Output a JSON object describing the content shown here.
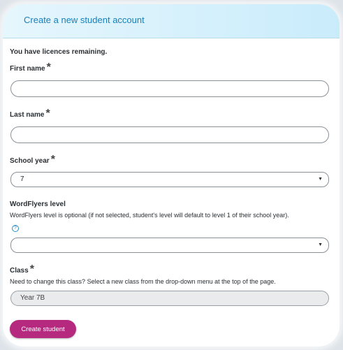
{
  "header": {
    "title": "Create a new student account"
  },
  "form": {
    "notice": "You have licences remaining.",
    "required_marker": "*",
    "first_name": {
      "label": "First name",
      "value": ""
    },
    "last_name": {
      "label": "Last name",
      "value": ""
    },
    "school_year": {
      "label": "School year",
      "selected": "7"
    },
    "wordflyers_level": {
      "label": "WordFlyers level",
      "help": "WordFlyers level is optional (if not selected, student's level will default to level 1 of their school year).",
      "help_icon": "question-circle-icon",
      "selected": ""
    },
    "class": {
      "label": "Class",
      "help": "Need to change this class? Select a new class from the drop-down menu at the top of the page.",
      "value": "Year 7B"
    },
    "submit_label": "Create student"
  },
  "colors": {
    "header_text": "#1a7fb8",
    "button": "#b52a7f",
    "header_bg": "#c9ecfb"
  }
}
